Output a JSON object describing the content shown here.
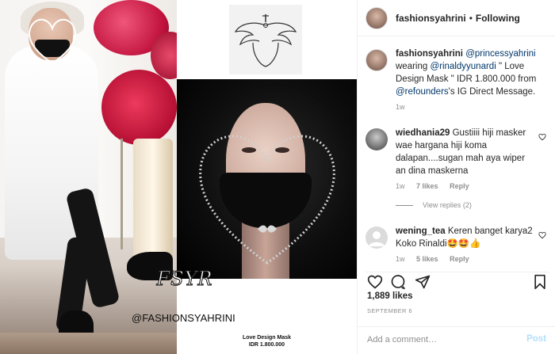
{
  "header": {
    "username": "fashionsyahrini",
    "separator": "•",
    "follow_label": "Following"
  },
  "caption": {
    "username": "fashionsyahrini",
    "mention1": "@princessyahrini",
    "text1": "wearing",
    "mention2": "@rinaldyyunardi",
    "text2": "\" Love Design Mask \" IDR 1.800.000 from",
    "mention3": "@refounders",
    "text3": "'s IG Direct Message.",
    "time": "1w"
  },
  "comments": [
    {
      "username": "wiedhania29",
      "text": "Gustiiii hiji masker wae hargana hiji koma dalapan....sugan mah aya wiper an dina maskerna",
      "time": "1w",
      "likes": "7 likes",
      "reply_label": "Reply",
      "view_replies": "View replies (2)"
    },
    {
      "username": "wening_tea",
      "text": "Keren banget karya2 Koko Rinaldi🤩🤩👍",
      "time": "1w",
      "likes": "5 likes",
      "reply_label": "Reply"
    }
  ],
  "likes_count": "1,889 likes",
  "post_date": "SEPTEMBER 6",
  "add_comment_placeholder": "Add a comment…",
  "post_label": "Post",
  "media": {
    "watermark": "FSYR",
    "watermark_handle": "@FASHIONSYAHRINI",
    "product_caption_line1": "Love Design Mask",
    "product_caption_line2": "IDR 1.800.000"
  },
  "icons": {
    "heart": "heart-icon",
    "comment": "comment-icon",
    "share": "share-icon",
    "save": "bookmark-icon"
  }
}
